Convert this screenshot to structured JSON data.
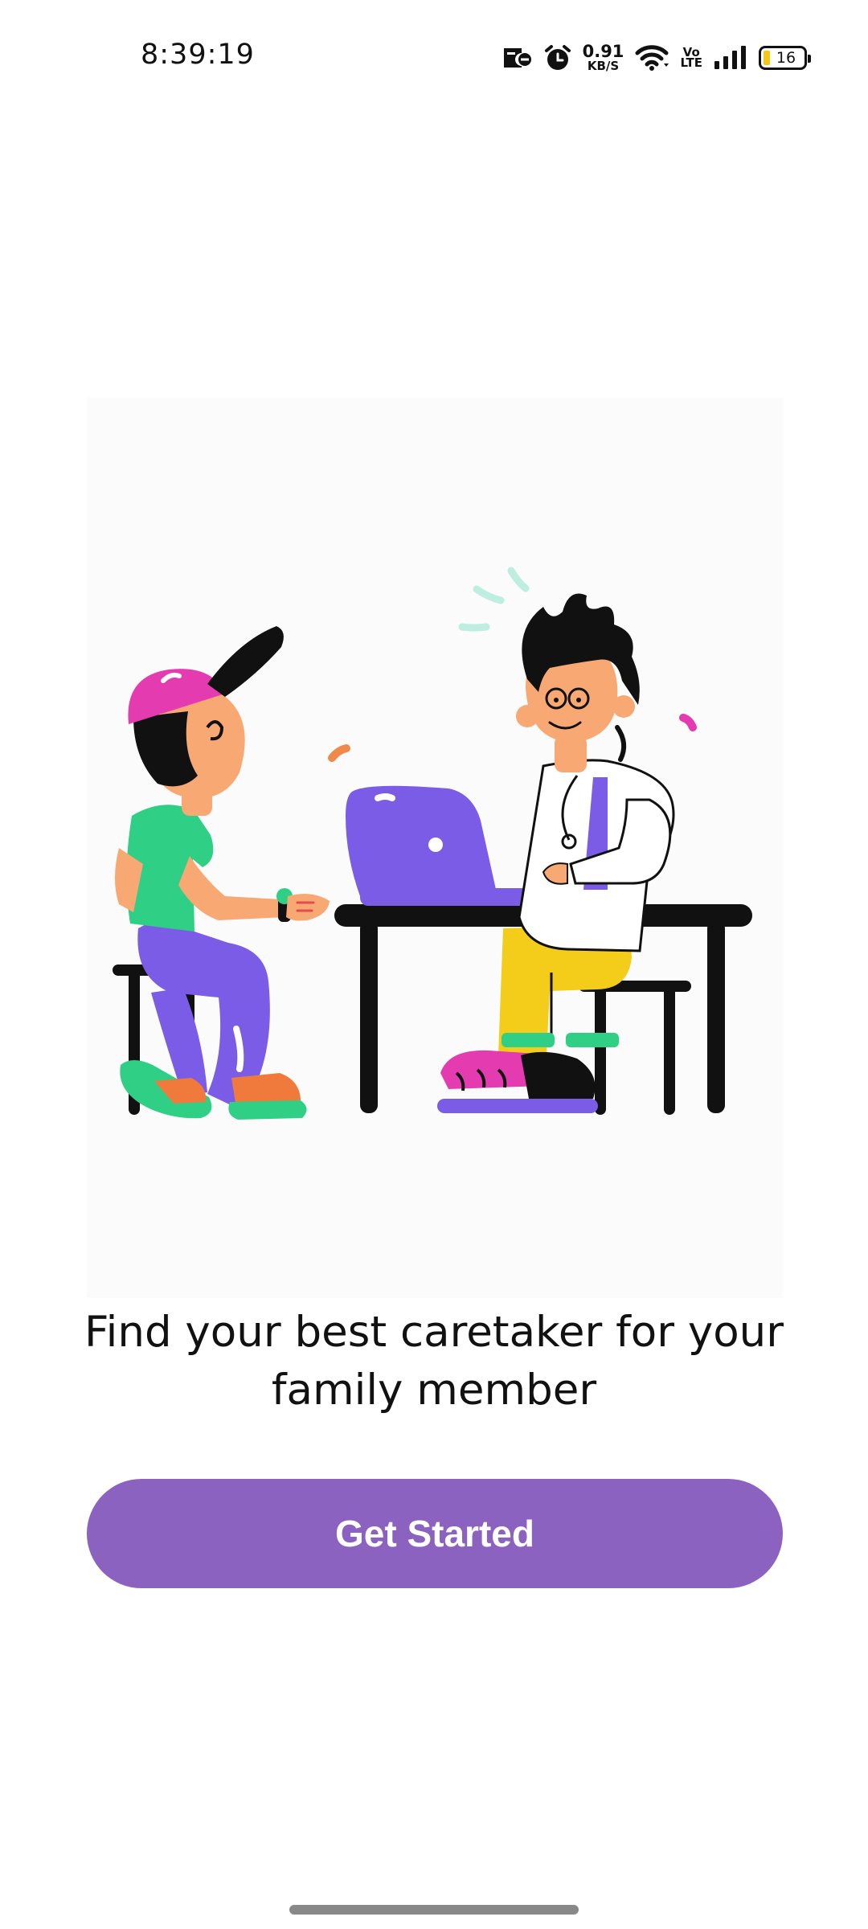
{
  "status_bar": {
    "time": "8:39:19",
    "net_speed_value": "0.91",
    "net_speed_unit": "KB/S",
    "volte_top": "Vo",
    "volte_bottom": "LTE",
    "battery_level": "16",
    "icons": [
      "notification-icon",
      "alarm-icon",
      "wifi-icon",
      "signal-icon",
      "battery-icon"
    ]
  },
  "onboarding": {
    "illustration_icon": "caretaker-consultation-illustration",
    "tagline_line1": "Find your best caretaker for your",
    "tagline_line2": "family member",
    "cta_label": "Get Started"
  },
  "colors": {
    "accent": "#8b62c0",
    "battery_fill": "#f5c518"
  }
}
